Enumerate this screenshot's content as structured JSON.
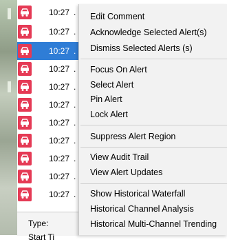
{
  "alerts": [
    {
      "time": "10:27",
      "selected": false
    },
    {
      "time": "10:27",
      "selected": false
    },
    {
      "time": "10:27",
      "selected": true
    },
    {
      "time": "10:27",
      "selected": false
    },
    {
      "time": "10:27",
      "selected": false
    },
    {
      "time": "10:27",
      "selected": false
    },
    {
      "time": "10:27",
      "selected": false
    },
    {
      "time": "10:27",
      "selected": false
    },
    {
      "time": "10:27",
      "selected": false
    },
    {
      "time": "10:27",
      "selected": false
    },
    {
      "time": "10:27",
      "selected": false
    }
  ],
  "alert_icon": "vehicle-alert-icon",
  "alert_icon_color": "#e53a55",
  "selection_color": "#2f7dd6",
  "details": {
    "type_label": "Type:",
    "start_label": "Start Ti"
  },
  "menu": {
    "items": [
      "Edit Comment",
      "Acknowledge Selected Alert(s)",
      "Dismiss Selected Alerts (s)",
      "Focus On Alert",
      "Select Alert",
      "Pin Alert",
      "Lock Alert",
      "Suppress Alert Region",
      "View Audit Trail",
      "View Alert Updates",
      "Show Historical Waterfall",
      "Historical Channel Analysis",
      "Historical Multi-Channel Trending"
    ]
  }
}
